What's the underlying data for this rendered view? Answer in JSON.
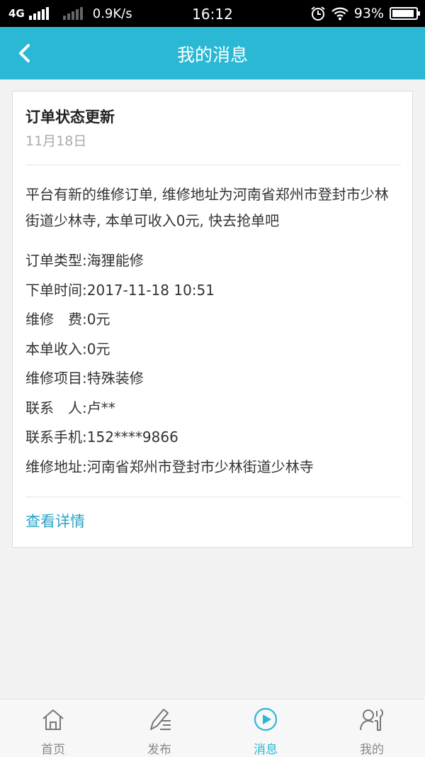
{
  "status_bar": {
    "network": "4G",
    "speed": "0.9K/s",
    "time": "16:12",
    "battery": "93%",
    "battery_level": 0.93
  },
  "header": {
    "title": "我的消息",
    "back_icon": "chevron-left-icon"
  },
  "message": {
    "title": "订单状态更新",
    "date": "11月18日",
    "body": "平台有新的维修订单, 维修地址为河南省郑州市登封市少林街道少林寺, 本单可收入0元, 快去抢单吧",
    "fields": [
      {
        "label": "订单类型: ",
        "value": "海狸能修"
      },
      {
        "label": "下单时间: ",
        "value": "2017-11-18 10:51"
      },
      {
        "label": "维修　费: ",
        "value": "0元"
      },
      {
        "label": "本单收入: ",
        "value": "0元"
      },
      {
        "label": "维修项目: ",
        "value": "特殊装修"
      },
      {
        "label": "联系　人: ",
        "value": "卢**"
      },
      {
        "label": "联系手机: ",
        "value": "152****9866"
      },
      {
        "label": "维修地址: ",
        "value": "河南省郑州市登封市少林街道少林寺"
      }
    ],
    "view_detail": "查看详情"
  },
  "nav": {
    "items": [
      {
        "label": "首页",
        "icon": "home-icon"
      },
      {
        "label": "发布",
        "icon": "edit-icon"
      },
      {
        "label": "消息",
        "icon": "play-circle-icon",
        "active": true
      },
      {
        "label": "我的",
        "icon": "user-tools-icon"
      }
    ]
  },
  "colors": {
    "accent": "#2ab8d4",
    "link": "#2aa3c7"
  }
}
